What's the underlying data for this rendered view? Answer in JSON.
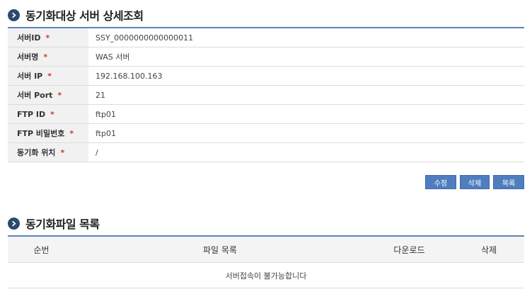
{
  "server_section": {
    "title": "동기화대상 서버 상세조회",
    "required_mark": "*",
    "rows": [
      {
        "label": "서버ID",
        "value": "SSY_0000000000000011"
      },
      {
        "label": "서버명",
        "value": "WAS 서버"
      },
      {
        "label": "서버 IP",
        "value": "192.168.100.163"
      },
      {
        "label": "서버 Port",
        "value": "21"
      },
      {
        "label": "FTP ID",
        "value": "ftp01"
      },
      {
        "label": "FTP 비밀번호",
        "value": "ftp01"
      },
      {
        "label": "동기화 위치",
        "value": "/"
      }
    ]
  },
  "buttons": {
    "edit": "수정",
    "delete": "삭제",
    "list": "목록"
  },
  "file_section": {
    "title": "동기화파일 목록",
    "columns": {
      "no": "순번",
      "file_list": "파일 목록",
      "download": "다운로드",
      "delete": "삭제"
    },
    "empty_message": "서버접속이 불가능합니다"
  },
  "colors": {
    "accent": "#5b86b8",
    "button": "#4f7ec0",
    "bullet": "#2b4a6e",
    "required": "#d2372b"
  }
}
